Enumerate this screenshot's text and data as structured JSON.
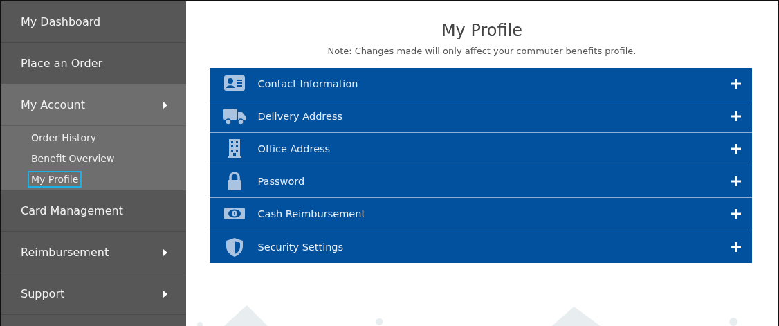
{
  "sidebar": {
    "items": [
      {
        "label": "My Dashboard",
        "kind": "link",
        "expanded": false
      },
      {
        "label": "Place an Order",
        "kind": "link",
        "expanded": false
      },
      {
        "label": "My Account",
        "kind": "menu",
        "expanded": true,
        "children": [
          {
            "label": "Order History",
            "selected": false
          },
          {
            "label": "Benefit Overview",
            "selected": false
          },
          {
            "label": "My Profile",
            "selected": true
          }
        ]
      },
      {
        "label": "Card Management",
        "kind": "link",
        "expanded": false
      },
      {
        "label": "Reimbursement",
        "kind": "menu",
        "expanded": false
      },
      {
        "label": "Support",
        "kind": "menu",
        "expanded": false
      }
    ]
  },
  "page": {
    "title": "My Profile",
    "note": "Note: Changes made will only affect your commuter benefits profile."
  },
  "sections": [
    {
      "label": "Contact Information",
      "expanded": false
    },
    {
      "label": "Delivery Address",
      "expanded": false
    },
    {
      "label": "Office Address",
      "expanded": false
    },
    {
      "label": "Password",
      "expanded": false
    },
    {
      "label": "Cash Reimbursement",
      "expanded": false
    },
    {
      "label": "Security Settings",
      "expanded": false
    }
  ]
}
